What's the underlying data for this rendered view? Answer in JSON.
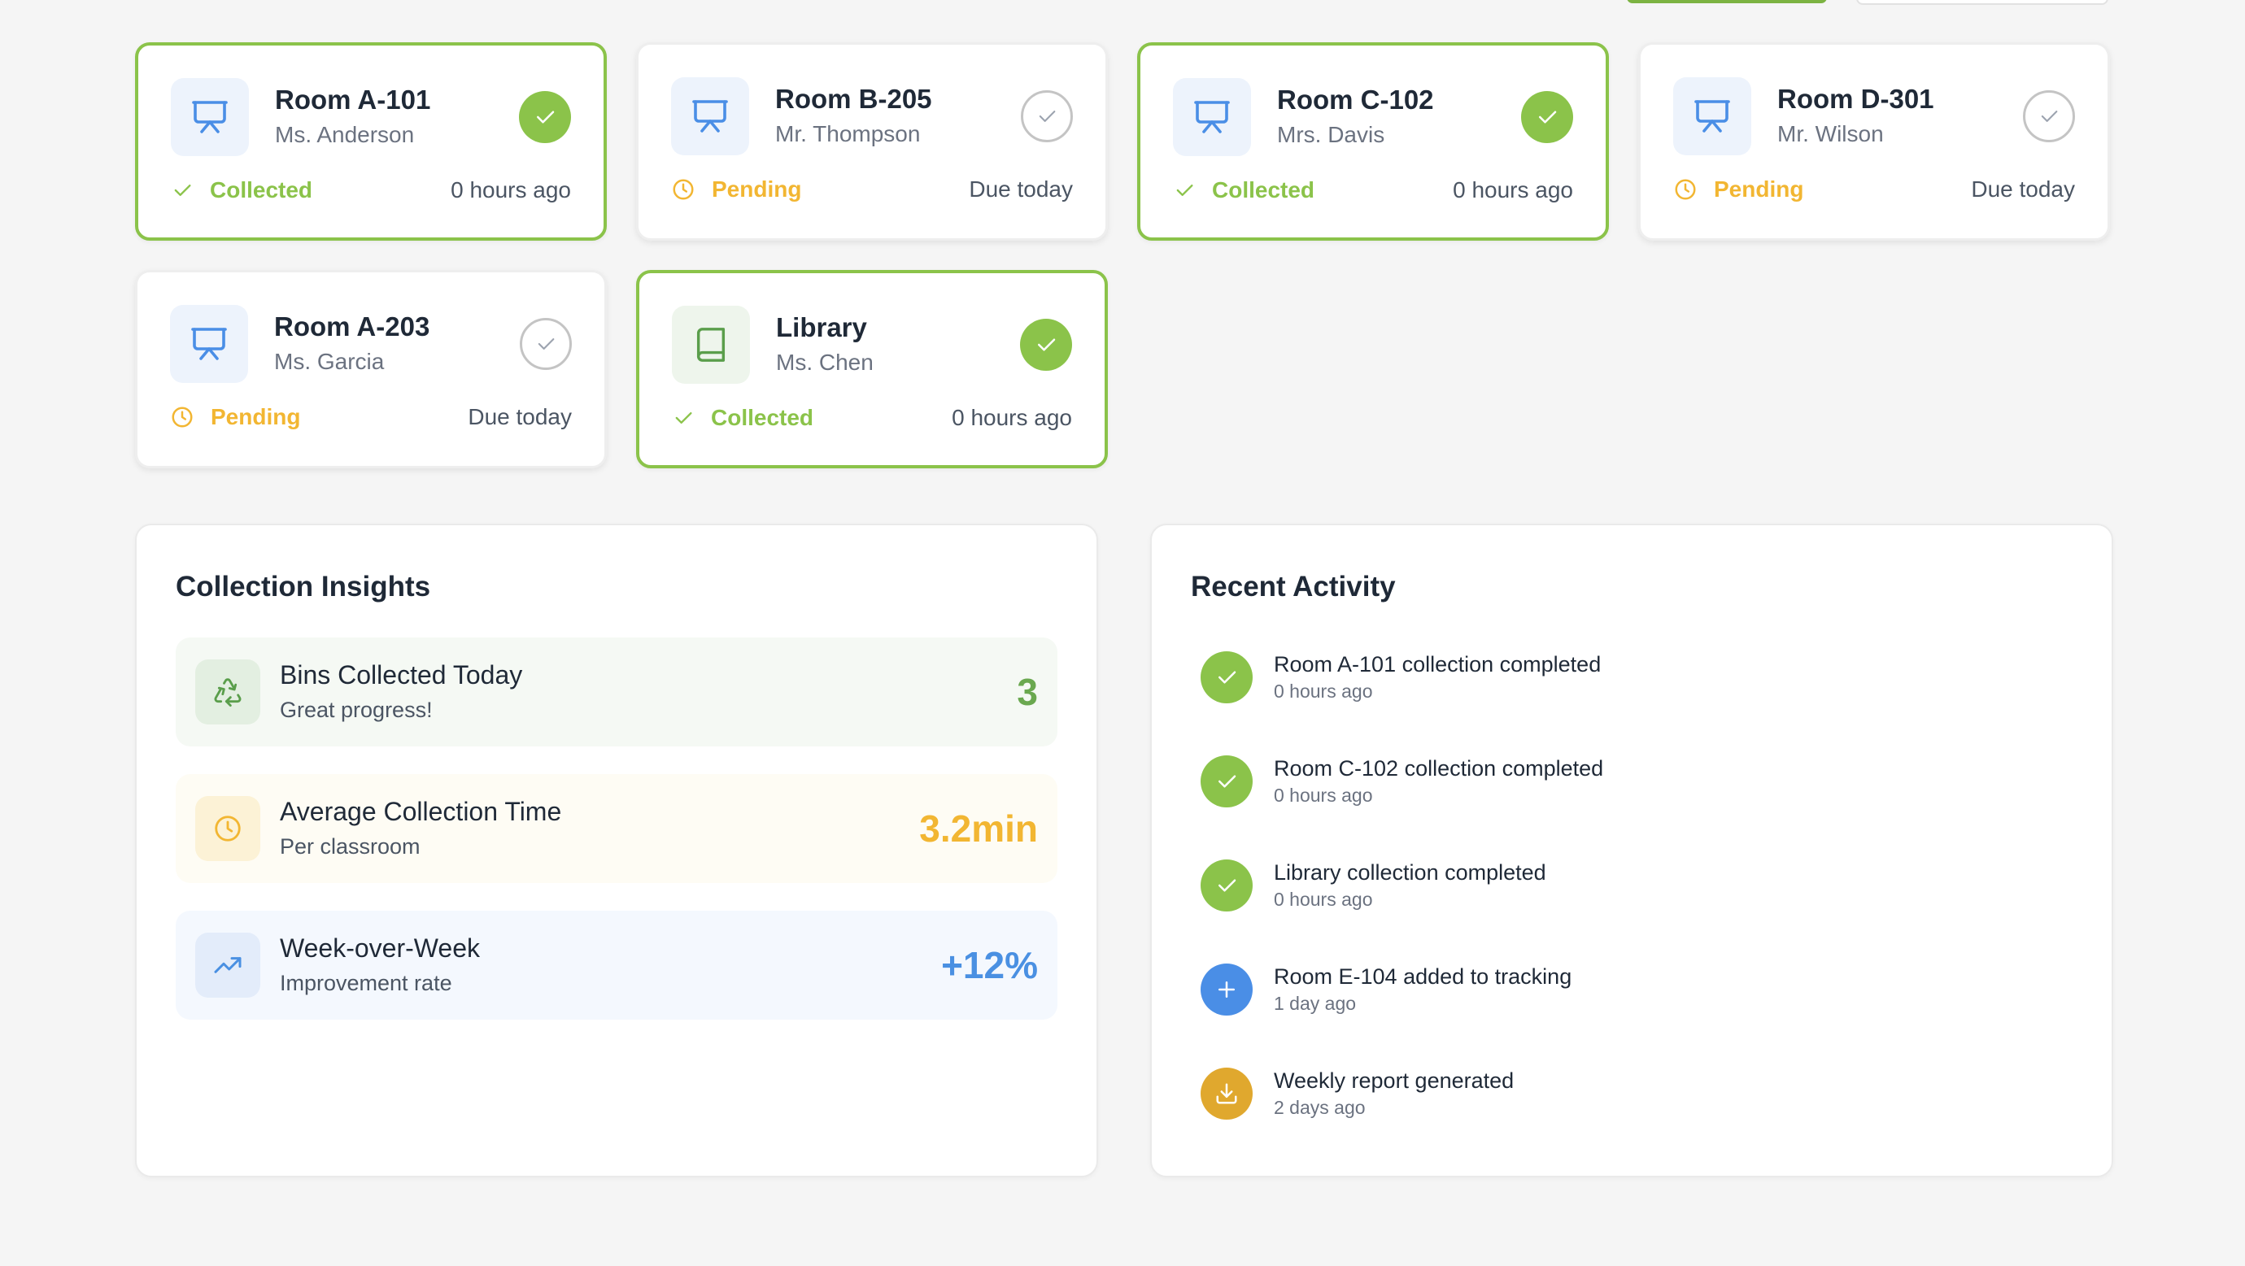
{
  "colors": {
    "green": "#8bc34a",
    "yellow": "#f2b632",
    "blue": "#4a90e2",
    "grey_border": "#c4c4c4"
  },
  "rooms": [
    {
      "name": "Room A-101",
      "teacher": "Ms. Anderson",
      "status": "Collected",
      "time": "0 hours ago",
      "icon": "presentation-board-icon",
      "collected": true
    },
    {
      "name": "Room B-205",
      "teacher": "Mr. Thompson",
      "status": "Pending",
      "time": "Due today",
      "icon": "presentation-board-icon",
      "collected": false
    },
    {
      "name": "Room C-102",
      "teacher": "Mrs. Davis",
      "status": "Collected",
      "time": "0 hours ago",
      "icon": "presentation-board-icon",
      "collected": true
    },
    {
      "name": "Room D-301",
      "teacher": "Mr. Wilson",
      "status": "Pending",
      "time": "Due today",
      "icon": "presentation-board-icon",
      "collected": false
    },
    {
      "name": "Room A-203",
      "teacher": "Ms. Garcia",
      "status": "Pending",
      "time": "Due today",
      "icon": "presentation-board-icon",
      "collected": false
    },
    {
      "name": "Library",
      "teacher": "Ms. Chen",
      "status": "Collected",
      "time": "0 hours ago",
      "icon": "book-icon",
      "collected": true
    }
  ],
  "insights": {
    "title": "Collection Insights",
    "items": [
      {
        "label": "Bins Collected Today",
        "sub": "Great progress!",
        "value": "3",
        "icon": "recycle-icon"
      },
      {
        "label": "Average Collection Time",
        "sub": "Per classroom",
        "value": "3.2min",
        "icon": "clock-icon"
      },
      {
        "label": "Week-over-Week",
        "sub": "Improvement rate",
        "value": "+12%",
        "icon": "trending-up-icon"
      }
    ]
  },
  "activity": {
    "title": "Recent Activity",
    "items": [
      {
        "title": "Room A-101 collection completed",
        "time": "0 hours ago",
        "icon": "check-icon"
      },
      {
        "title": "Room C-102 collection completed",
        "time": "0 hours ago",
        "icon": "check-icon"
      },
      {
        "title": "Library collection completed",
        "time": "0 hours ago",
        "icon": "check-icon"
      },
      {
        "title": "Room E-104 added to tracking",
        "time": "1 day ago",
        "icon": "plus-icon"
      },
      {
        "title": "Weekly report generated",
        "time": "2 days ago",
        "icon": "download-icon"
      }
    ]
  }
}
